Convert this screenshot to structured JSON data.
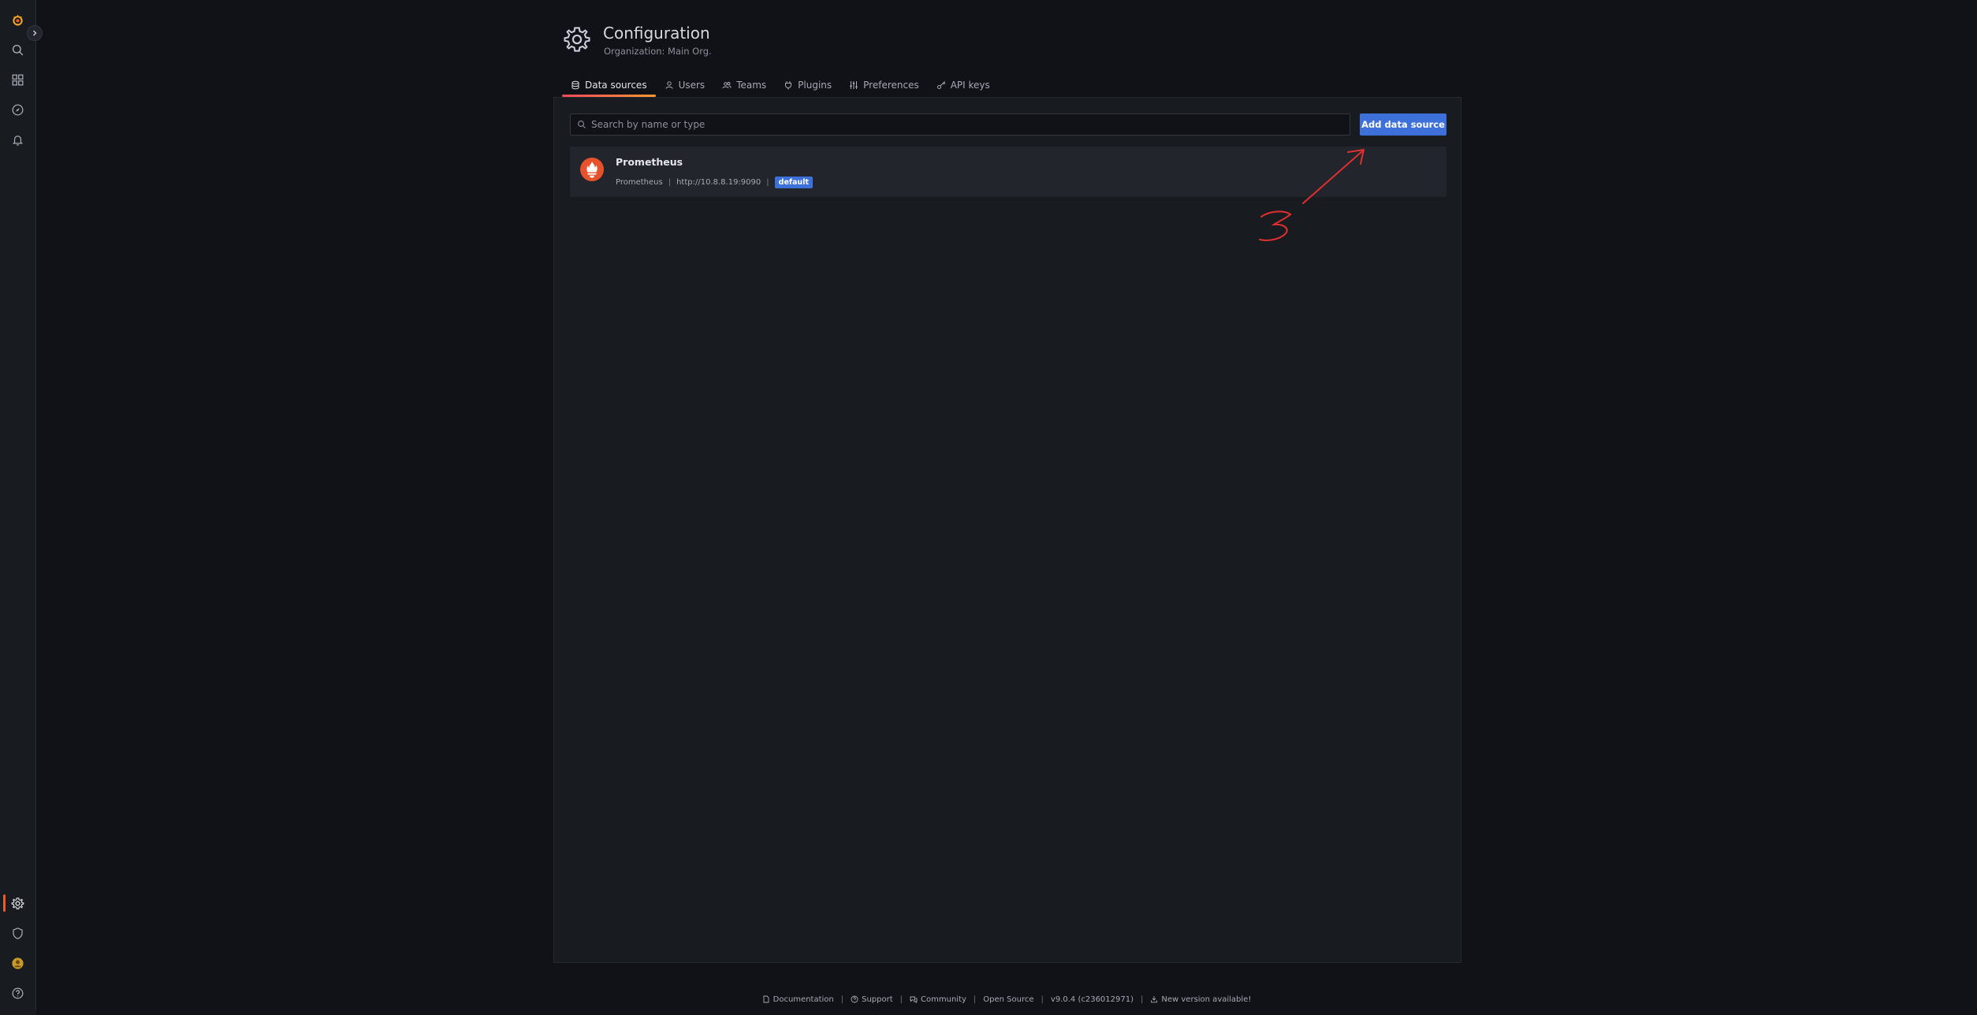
{
  "header": {
    "title": "Configuration",
    "subtitle": "Organization: Main Org."
  },
  "tabs": [
    {
      "label": "Data sources",
      "icon": "database-icon",
      "active": true
    },
    {
      "label": "Users",
      "icon": "user-icon",
      "active": false
    },
    {
      "label": "Teams",
      "icon": "users-icon",
      "active": false
    },
    {
      "label": "Plugins",
      "icon": "plug-icon",
      "active": false
    },
    {
      "label": "Preferences",
      "icon": "sliders-icon",
      "active": false
    },
    {
      "label": "API keys",
      "icon": "key-icon",
      "active": false
    }
  ],
  "search": {
    "placeholder": "Search by name or type"
  },
  "toolbar": {
    "add_label": "Add data source"
  },
  "datasource": {
    "name": "Prometheus",
    "type": "Prometheus",
    "url": "http://10.8.8.19:9090",
    "badge": "default",
    "logo": "prometheus-logo"
  },
  "footer": {
    "documentation": "Documentation",
    "support": "Support",
    "community": "Community",
    "open_source": "Open Source",
    "version": "v9.0.4 (c236012971)",
    "new_version": "New version available!"
  },
  "colors": {
    "accent": "#3d71d9",
    "brand": "#f05a28",
    "annotation": "#e02f2f"
  }
}
